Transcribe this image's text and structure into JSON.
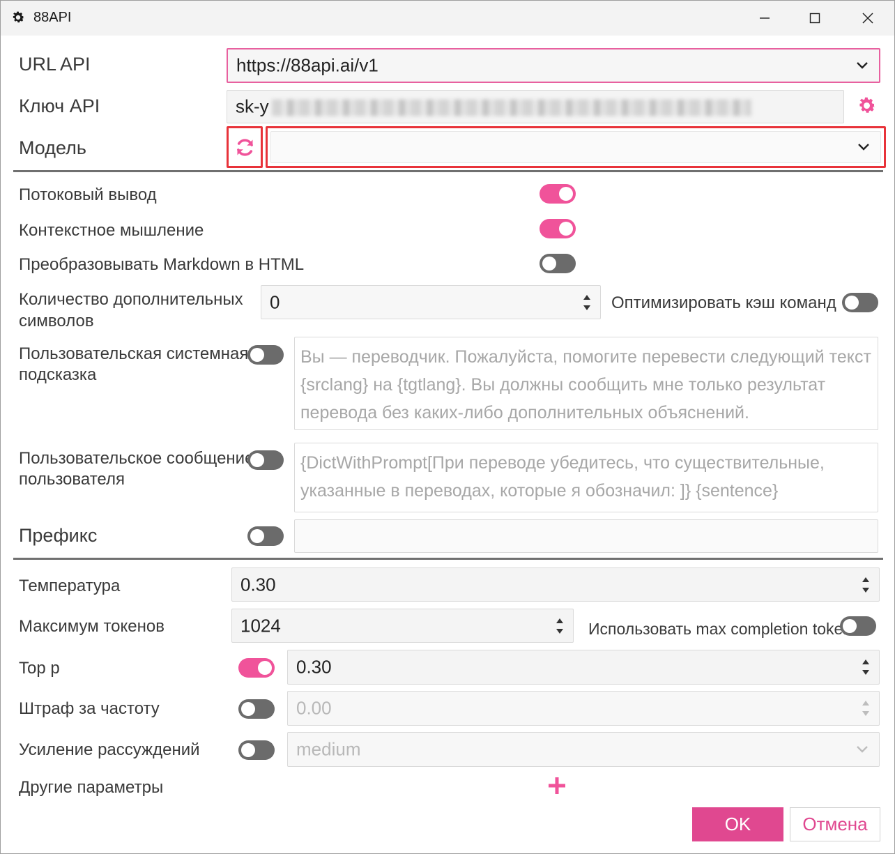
{
  "window": {
    "title": "88API"
  },
  "api": {
    "url_label": "URL API",
    "url_value": "https://88api.ai/v1",
    "key_label": "Ключ API",
    "key_value_prefix": "sk-y",
    "model_label": "Модель",
    "model_value": ""
  },
  "toggles": {
    "streaming_label": "Потоковый вывод",
    "streaming_on": true,
    "context_label": "Контекстное мышление",
    "context_on": true,
    "markdown_label": "Преобразовывать Markdown в HTML",
    "markdown_on": false
  },
  "extra_chars": {
    "label_line1": "Количество дополнительных",
    "label_line2": "символов",
    "value": "0",
    "cache_label": "Оптимизировать кэш команд",
    "cache_on": false
  },
  "system_prompt": {
    "label_line1": "Пользовательская системная",
    "label_line2": "подсказка",
    "on": false,
    "text": "Вы — переводчик. Пожалуйста, помогите перевести следующий текст {srclang} на {tgtlang}. Вы должны сообщить мне только результат перевода без каких-либо дополнительных объяснений."
  },
  "user_message": {
    "label_line1": "Пользовательское сообщение",
    "label_line2": "пользователя",
    "on": false,
    "text": "{DictWithPrompt[При переводе убедитесь, что существительные, указанные в переводах, которые я обозначил: ]} {sentence}"
  },
  "prefix": {
    "label": "Префикс",
    "on": false,
    "value": ""
  },
  "params": {
    "temperature_label": "Температура",
    "temperature_value": "0.30",
    "max_tokens_label": "Максимум токенов",
    "max_tokens_value": "1024",
    "max_completion_label": "Использовать max completion tokens",
    "max_completion_on": false,
    "top_p_label": "Top p",
    "top_p_on": true,
    "top_p_value": "0.30",
    "freq_label": "Штраф за частоту",
    "freq_on": false,
    "freq_value": "0.00",
    "reasoning_label": "Усиление рассуждений",
    "reasoning_on": false,
    "reasoning_value": "medium",
    "other_label": "Другие параметры"
  },
  "buttons": {
    "ok": "OK",
    "cancel": "Отмена"
  },
  "colors": {
    "accent": "#e04890",
    "toggle_on": "#f0539a",
    "highlight": "#e8333a"
  },
  "icons": {
    "app": "gear-icon",
    "refresh": "refresh-icon",
    "settings": "gear-icon",
    "add": "plus-icon"
  }
}
